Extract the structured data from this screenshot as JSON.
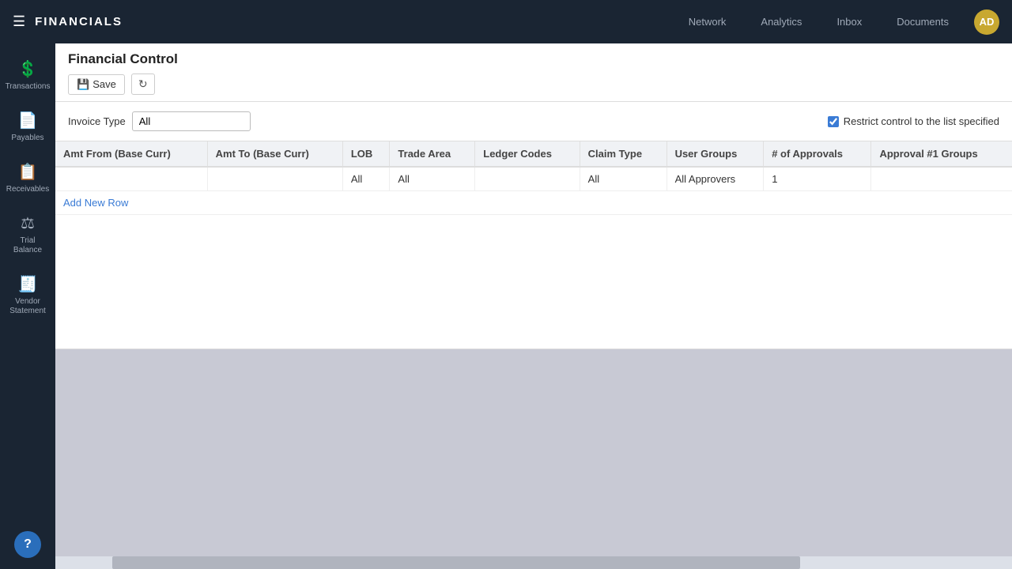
{
  "navbar": {
    "menu_icon": "☰",
    "brand": "FINANCIALS",
    "links": [
      {
        "label": "Network",
        "active": false
      },
      {
        "label": "Analytics",
        "active": false
      },
      {
        "label": "Inbox",
        "active": false
      },
      {
        "label": "Documents",
        "active": false
      }
    ],
    "avatar": "AD"
  },
  "sidebar": {
    "items": [
      {
        "id": "transactions",
        "label": "Transactions",
        "icon": "💲"
      },
      {
        "id": "payables",
        "label": "Payables",
        "icon": "📄"
      },
      {
        "id": "receivables",
        "label": "Receivables",
        "icon": "📋"
      },
      {
        "id": "trial-balance",
        "label": "Trial Balance",
        "icon": "⚖"
      },
      {
        "id": "vendor-statement",
        "label": "Vendor Statement",
        "icon": "🧾"
      }
    ],
    "help_label": "?"
  },
  "page": {
    "title": "Financial Control",
    "toolbar": {
      "save_label": "Save",
      "refresh_label": "↻"
    },
    "form": {
      "invoice_type_label": "Invoice Type",
      "invoice_type_value": "All",
      "checkbox_checked": true,
      "checkbox_label": "Restrict control to the list specified"
    },
    "table": {
      "columns": [
        "Amt From (Base Curr)",
        "Amt To (Base Curr)",
        "LOB",
        "Trade Area",
        "Ledger Codes",
        "Claim Type",
        "User Groups",
        "# of Approvals",
        "Approval #1 Groups"
      ],
      "rows": [
        {
          "amt_from": "",
          "amt_to": "",
          "lob": "All",
          "trade_area": "All",
          "ledger_codes": "",
          "claim_type": "All",
          "user_groups": "All Approvers",
          "num_approvals": "1",
          "approval_groups": ""
        }
      ],
      "add_row_label": "Add New Row"
    }
  }
}
